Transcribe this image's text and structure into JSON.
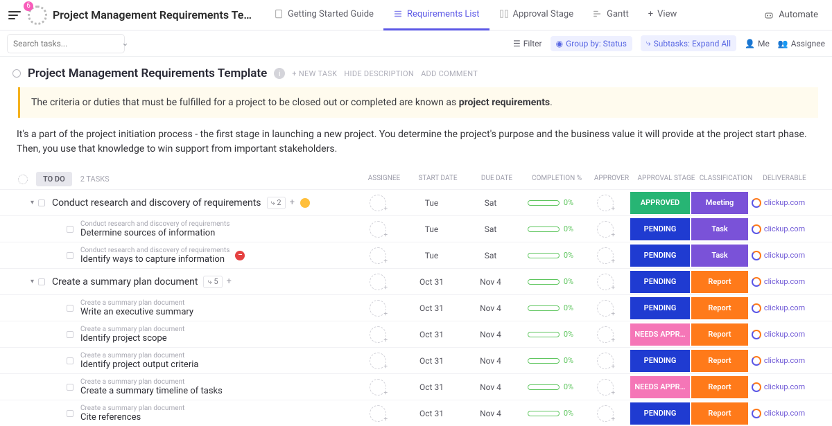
{
  "header": {
    "badge": "6",
    "title": "Project Management Requirements Te…",
    "tabs": [
      {
        "label": "Getting Started Guide"
      },
      {
        "label": "Requirements List"
      },
      {
        "label": "Approval Stage"
      },
      {
        "label": "Gantt"
      },
      {
        "label": "View"
      }
    ],
    "automate": "Automate"
  },
  "toolbar": {
    "search_placeholder": "Search tasks...",
    "filter": "Filter",
    "group": "Group by: Status",
    "subtasks": "Subtasks: Expand All",
    "me": "Me",
    "assignee": "Assignee"
  },
  "heading": {
    "title": "Project Management Requirements Template",
    "new_task": "+ NEW TASK",
    "hide": "HIDE DESCRIPTION",
    "comment": "ADD COMMENT"
  },
  "banner": {
    "text_a": "The criteria or duties that must be fulfilled for a project to be closed out or completed are known as ",
    "text_b": "project requirements",
    "text_c": "."
  },
  "description": "It's a part of the project initiation process - the first stage in launching a new project. You determine the project's purpose and the business value it will provide at the project start phase. Then, you use that knowledge to win support from important stakeholders.",
  "group": {
    "status": "TO DO",
    "count": "2 TASKS"
  },
  "columns": {
    "assignee": "ASSIGNEE",
    "start": "START DATE",
    "due": "DUE DATE",
    "completion": "COMPLETION %",
    "approver": "APPROVER",
    "stage": "APPROVAL STAGE",
    "class": "CLASSIFICATION",
    "deliverable": "DELIVERABLE"
  },
  "rows": [
    {
      "type": "parent",
      "name": "Conduct research and discovery of requirements",
      "sub_count": "2",
      "flag": "yellow",
      "start": "Tue",
      "due": "Sat",
      "pct": "0%",
      "stage": "APPROVED",
      "stage_cls": "st-approved",
      "class": "Meeting",
      "class_cls": "cl-meeting",
      "deliv": "clickup.com"
    },
    {
      "type": "sub",
      "parent": "Conduct research and discovery of requirements",
      "name": "Determine sources of information",
      "start": "Tue",
      "due": "Sat",
      "pct": "0%",
      "stage": "PENDING",
      "stage_cls": "st-pending",
      "class": "Task",
      "class_cls": "cl-task",
      "deliv": "clickup.com"
    },
    {
      "type": "sub",
      "parent": "Conduct research and discovery of requirements",
      "name": "Identify ways to capture information",
      "flag": "red",
      "start": "Tue",
      "due": "Sat",
      "pct": "0%",
      "stage": "PENDING",
      "stage_cls": "st-pending",
      "class": "Task",
      "class_cls": "cl-task",
      "deliv": "clickup.com"
    },
    {
      "type": "parent",
      "name": "Create a summary plan document",
      "sub_count": "5",
      "start": "Oct 31",
      "due": "Nov 4",
      "pct": "0%",
      "stage": "PENDING",
      "stage_cls": "st-pending",
      "class": "Report",
      "class_cls": "cl-report",
      "deliv": "clickup.com"
    },
    {
      "type": "sub",
      "parent": "Create a summary plan document",
      "name": "Write an executive summary",
      "start": "Oct 31",
      "due": "Nov 4",
      "pct": "0%",
      "stage": "PENDING",
      "stage_cls": "st-pending",
      "class": "Report",
      "class_cls": "cl-report",
      "deliv": "clickup.com"
    },
    {
      "type": "sub",
      "parent": "Create a summary plan document",
      "name": "Identify project scope",
      "start": "Oct 31",
      "due": "Nov 4",
      "pct": "0%",
      "stage": "NEEDS APPR…",
      "stage_cls": "st-needs",
      "class": "Report",
      "class_cls": "cl-report",
      "deliv": "clickup.com"
    },
    {
      "type": "sub",
      "parent": "Create a summary plan document",
      "name": "Identify project output criteria",
      "start": "Oct 31",
      "due": "Nov 4",
      "pct": "0%",
      "stage": "PENDING",
      "stage_cls": "st-pending",
      "class": "Report",
      "class_cls": "cl-report",
      "deliv": "clickup.com"
    },
    {
      "type": "sub",
      "parent": "Create a summary plan document",
      "name": "Create a summary timeline of tasks",
      "start": "Oct 31",
      "due": "Nov 4",
      "pct": "0%",
      "stage": "NEEDS APPR…",
      "stage_cls": "st-needs",
      "class": "Report",
      "class_cls": "cl-report",
      "deliv": "clickup.com"
    },
    {
      "type": "sub",
      "parent": "Create a summary plan document",
      "name": "Cite references",
      "start": "Oct 31",
      "due": "Nov 4",
      "pct": "0%",
      "stage": "PENDING",
      "stage_cls": "st-pending",
      "class": "Report",
      "class_cls": "cl-report",
      "deliv": "clickup.com"
    }
  ]
}
